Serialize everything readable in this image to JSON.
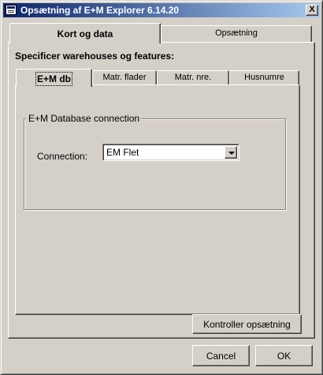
{
  "window": {
    "title": "Opsætning af E+M Explorer 6.14.20",
    "close_label": "X"
  },
  "outer_tabs": [
    {
      "label": "Kort og data",
      "active": true
    },
    {
      "label": "Opsætning",
      "active": false
    }
  ],
  "section_heading": "Specificer warehouses og features:",
  "inner_tabs": [
    {
      "label": "E+M db",
      "active": true
    },
    {
      "label": "Matr. flader",
      "active": false
    },
    {
      "label": "Matr. nre.",
      "active": false
    },
    {
      "label": "Husnumre",
      "active": false
    }
  ],
  "db_group": {
    "legend": "E+M Database connection",
    "connection_label": "Connection:",
    "connection_value": "EM Flet"
  },
  "buttons": {
    "check_setup": "Kontroller opsætning",
    "cancel": "Cancel",
    "ok": "OK"
  }
}
